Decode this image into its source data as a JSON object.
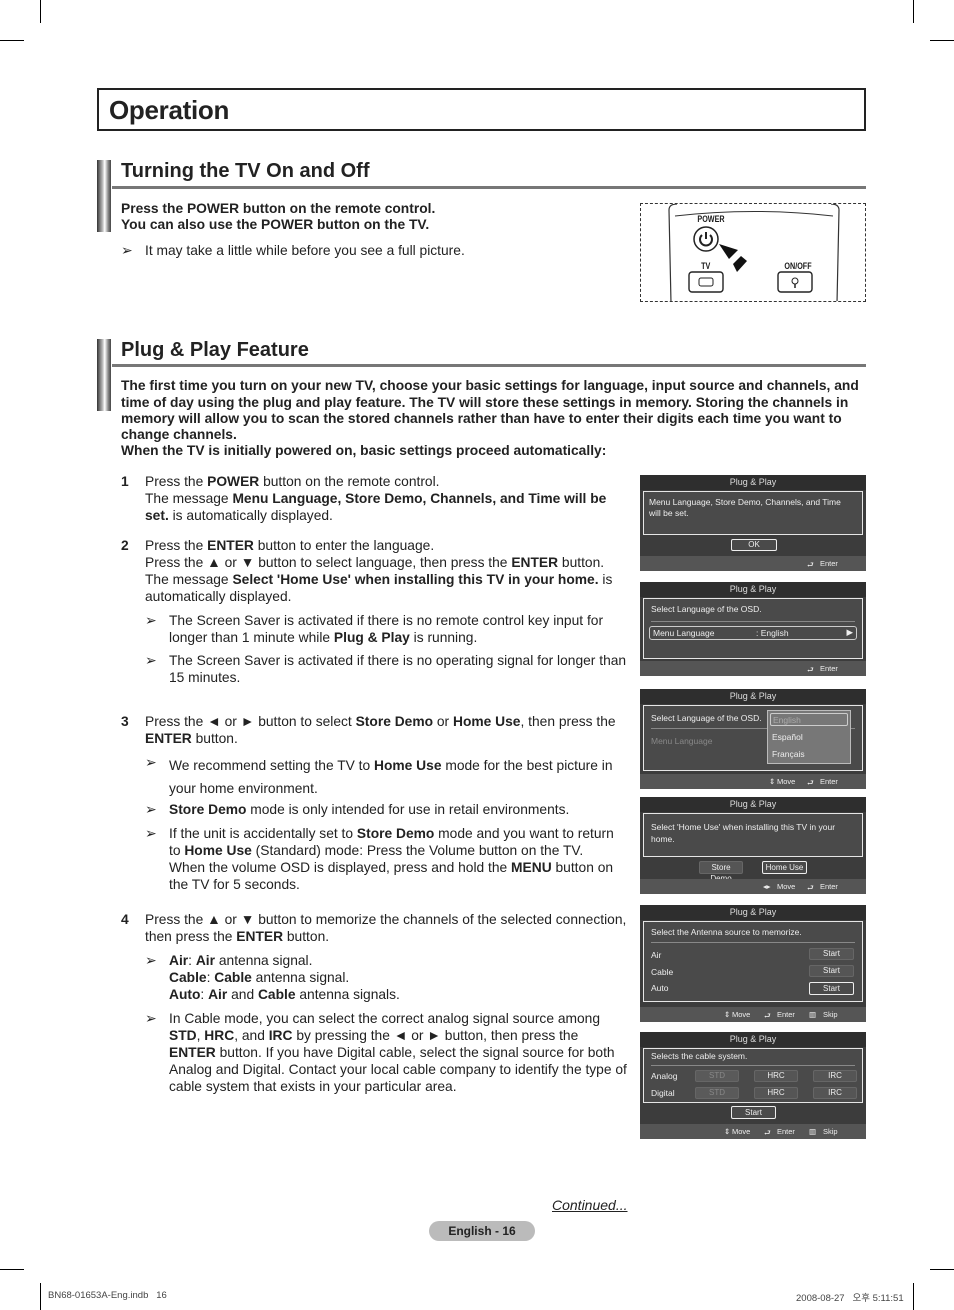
{
  "page_title": "Operation",
  "section1": {
    "title": "Turning the TV On and Off",
    "intro_line1": "Press the POWER button on the remote control.",
    "intro_line2": "You can also use the POWER button on the TV.",
    "note": "It may take a little while before you see a full picture.",
    "remote": {
      "power_label": "POWER",
      "tv_label": "TV",
      "onoff_label": "ON/OFF"
    }
  },
  "section2": {
    "title": "Plug & Play Feature",
    "intro_lines": [
      "The first time you turn on your new TV, choose your basic settings for language, input source and channels, and",
      "time of day using the plug and play feature. The TV will store these settings in memory. Storing the channels in",
      "memory will allow you to scan the stored channels rather than have to enter their digits each time you want to",
      "change channels.",
      "When the TV is initially powered on, basic settings proceed automatically:"
    ],
    "steps": [
      {
        "num": "1",
        "l1a": "Press the ",
        "l1b": "POWER",
        "l1c": " button on the remote control.",
        "l2a": "The message ",
        "l2b": "Menu Language, Store Demo, Channels, and Time will be",
        "l3a": "set.",
        "l3b": " is automatically displayed."
      },
      {
        "num": "2",
        "l1a": "Press the ",
        "l1b": "ENTER",
        "l1c": " button to enter the language.",
        "l2a": "Press the ▲ or ▼ button to select language, then press the ",
        "l2b": "ENTER",
        "l2c": " button.",
        "l3a": "The message ",
        "l3b": "Select 'Home Use' when installing this TV in your home.",
        "l3c": " is",
        "l4": "automatically displayed.",
        "notes": [
          {
            "a": "The Screen Saver is activated if there is no remote control key input for",
            "b": "longer than 1 minute while ",
            "c": "Plug & Play",
            "d": " is running."
          },
          {
            "a": "The Screen Saver is activated if there is no operating signal for longer than",
            "b": "15 minutes."
          }
        ]
      },
      {
        "num": "3",
        "l1a": "Press the ◄ or ► button to select ",
        "l1b": "Store Demo",
        "l1c": " or ",
        "l1d": "Home Use",
        "l1e": ", then press the",
        "l2a": "ENTER",
        "l2b": " button.",
        "notes": [
          {
            "a": "We recommend setting the TV to ",
            "b": "Home Use",
            "c": " mode for the best picture in",
            "d": "your home environment."
          },
          {
            "a": "Store Demo",
            "b": " mode is only intended for use in retail environments."
          },
          {
            "a": "If the unit is accidentally set to ",
            "b": "Store Demo",
            "c": " mode and you want to return",
            "d": "to ",
            "e": "Home Use",
            "f": " (Standard) mode: Press the Volume button on the TV.",
            "g": "When the volume OSD is displayed, press and hold the ",
            "h": "MENU",
            "i": " button on",
            "j": "the TV for 5 seconds."
          }
        ]
      },
      {
        "num": "4",
        "l1": "Press the ▲ or ▼ button to memorize the channels of the selected connection,",
        "l2a": "then press the ",
        "l2b": "ENTER",
        "l2c": " button.",
        "notes": [
          {
            "air_a": "Air",
            "air_b": ": ",
            "air_c": "Air",
            "air_d": " antenna signal.",
            "cab_a": "Cable",
            "cab_b": ": ",
            "cab_c": "Cable",
            "cab_d": " antenna signal.",
            "auto_a": "Auto",
            "auto_b": ": ",
            "auto_c": "Air",
            "auto_d": " and ",
            "auto_e": "Cable",
            "auto_f": " antenna signals."
          },
          {
            "l1": "In Cable mode, you can select the correct analog signal source among",
            "l2a": "STD",
            "l2b": ", ",
            "l2c": "HRC",
            "l2d": ", and ",
            "l2e": "IRC",
            "l2f": " by pressing the ◄ or ► button, then press the",
            "l3a": "ENTER",
            "l3b": " button. If you have Digital cable, select the signal source for both",
            "l4": "Analog and Digital. Contact your local cable company to identify the type of",
            "l5": "cable system that exists in your particular area."
          }
        ]
      }
    ]
  },
  "osd": {
    "header": "Plug & Play",
    "enter": "Enter",
    "move": "Move",
    "skip": "Skip",
    "s1": {
      "message": "Menu Language, Store Demo, Channels, and Time will be set.",
      "ok": "OK"
    },
    "s2": {
      "message": "Select Language of the OSD.",
      "field": "Menu Language",
      "value": ": English"
    },
    "s3": {
      "message": "Select Language of the OSD.",
      "field": "Menu Language",
      "options": [
        "English",
        "Español",
        "Français"
      ],
      "selected": "English"
    },
    "s4": {
      "message": "Select 'Home Use' when installing this TV in your home.",
      "store_demo": "Store Demo",
      "home_use": "Home Use"
    },
    "s5": {
      "message": "Select the Antenna source to memorize.",
      "rows": [
        "Air",
        "Cable",
        "Auto"
      ],
      "start": "Start"
    },
    "s6": {
      "message": "Selects the cable system.",
      "rows": [
        "Analog",
        "Digital"
      ],
      "options": [
        "STD",
        "HRC",
        "IRC"
      ],
      "start": "Start"
    }
  },
  "footer": {
    "continued": "Continued...",
    "page_label": "English - 16",
    "file_name": "BN68-01653A-Eng.indb   16",
    "timestamp": "2008-08-27   오후 5:11:51"
  }
}
